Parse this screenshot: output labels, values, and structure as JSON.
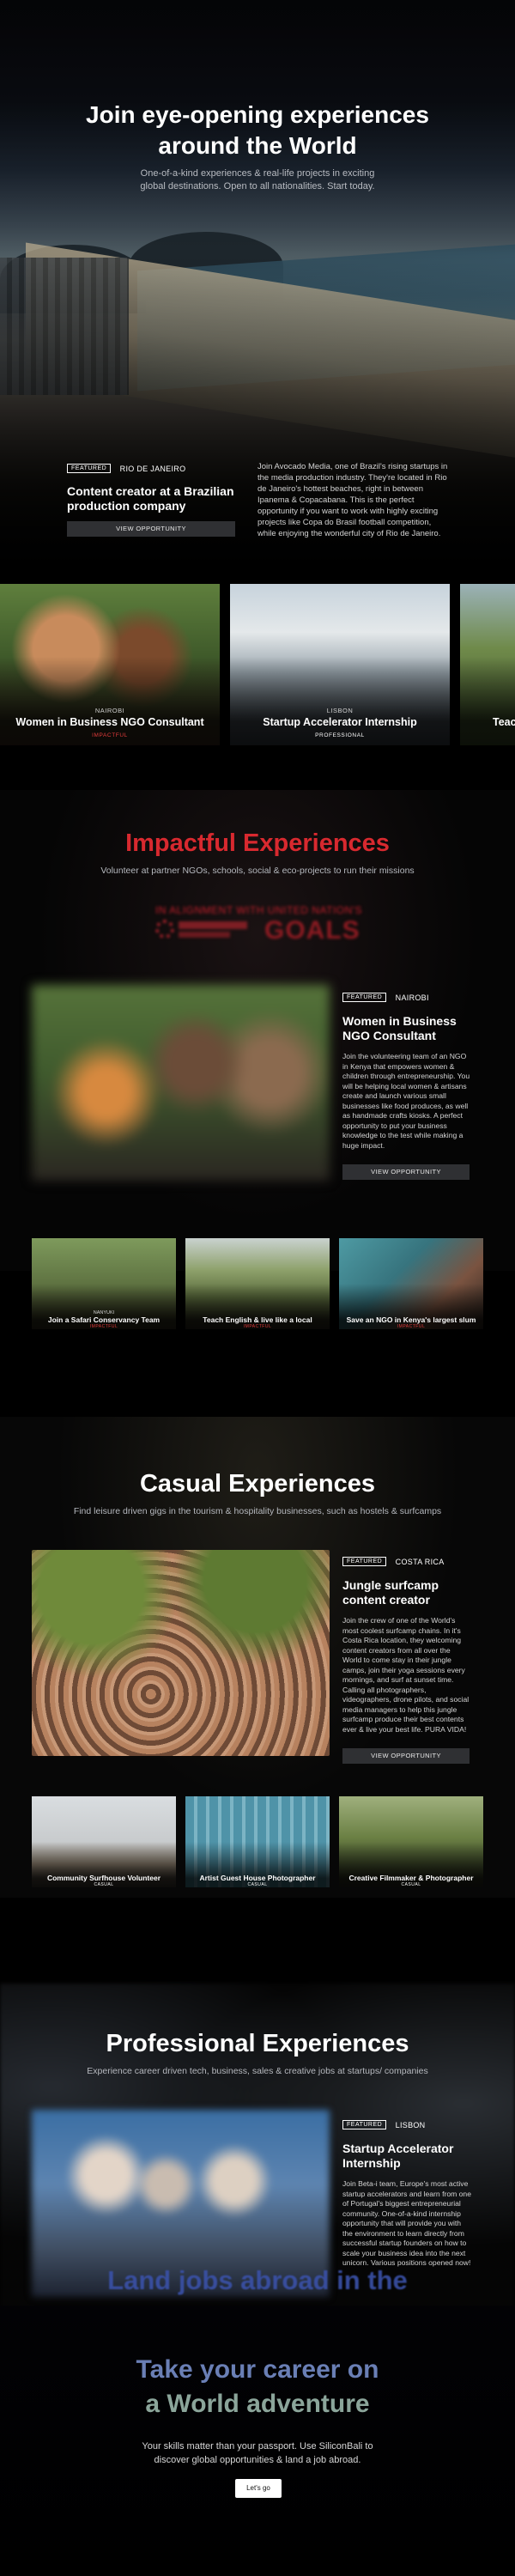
{
  "hero": {
    "title_line1": "Join eye-opening experiences",
    "title_line2": "around the World",
    "subtitle": "One-of-a-kind experiences & real-life projects in exciting global destinations. Open to all nationalities. Start today.",
    "featured": {
      "badge": "FEATURED",
      "location": "RIO DE JANEIRO",
      "title": "Content creator at a Brazilian production company",
      "button": "VIEW OPPORTUNITY",
      "description": "Join Avocado Media, one of Brazil's rising startups in the media production industry. They're located in Rio de Janeiro's hottest beaches, right in between Ipanema & Copacabana. This is the perfect opportunity if you want to work with highly exciting projects like Copa do Brasil football competition, while enjoying the wonderful city of Rio de Janeiro."
    }
  },
  "carousel": [
    {
      "sublabel": "NAIROBI",
      "title": "Women in Business NGO Consultant",
      "tag": "IMPACTFUL",
      "tag_color": "#e23b3b"
    },
    {
      "sublabel": "LISBON",
      "title": "Startup Accelerator Internship",
      "tag": "PROFESSIONAL",
      "tag_color": "#ffffff"
    },
    {
      "sublabel": "",
      "title": "Teac",
      "tag": "",
      "tag_color": "#ffffff"
    }
  ],
  "impactful": {
    "title": "Impactful Experiences",
    "title_color": "#d8292f",
    "subtitle": "Volunteer at partner NGOs, schools, social & eco-projects to run their missions",
    "sdg_text": "IN ALIGNMENT WITH UNITED NATION'S",
    "sdg_goals": "GOALS",
    "featured": {
      "badge": "FEATURED",
      "location": "NAIROBI",
      "title": "Women in Business NGO Consultant",
      "description": "Join the volunteering team of an NGO in Kenya that empowers women & children through entrepreneurship. You will be helping local women & artisans create and launch various small businesses like food produces, as well as handmade crafts kiosks. A perfect opportunity to put your business knowledge to the test while making a huge impact.",
      "button": "VIEW OPPORTUNITY"
    },
    "cards": [
      {
        "sublabel": "NANYUKI",
        "title": "Join a Safari Conservancy Team",
        "tag": "IMPACTFUL"
      },
      {
        "sublabel": "",
        "title": "Teach English & live like a local",
        "tag": "IMPACTFUL"
      },
      {
        "sublabel": "",
        "title": "Save an NGO in Kenya's largest slum",
        "tag": "IMPACTFUL"
      }
    ]
  },
  "casual": {
    "title": "Casual Experiences",
    "subtitle": "Find leisure driven gigs in the tourism & hospitality businesses, such as hostels & surfcamps",
    "featured": {
      "badge": "FEATURED",
      "location": "COSTA RICA",
      "title": "Jungle surfcamp content creator",
      "description": "Join the crew of one of the World's most coolest surfcamp chains. In it's Costa Rica location, they welcoming content creators from all over the World to come stay in their jungle camps, join their yoga sessions every mornings, and surf at sunset time. Calling all photographers, videographers, drone pilots, and social media managers to help this jungle surfcamp produce their best contents ever & live your best life. PURA VIDA!",
      "button": "VIEW OPPORTUNITY"
    },
    "cards": [
      {
        "sublabel": "",
        "title": "Community Surfhouse Volunteer",
        "tag": "CASUAL"
      },
      {
        "sublabel": "",
        "title": "Artist Guest House Photographer",
        "tag": "CASUAL"
      },
      {
        "sublabel": "",
        "title": "Creative Filmmaker & Photographer",
        "tag": "CASUAL"
      }
    ]
  },
  "professional": {
    "title": "Professional Experiences",
    "subtitle": "Experience career driven tech, business, sales & creative jobs at startups/ companies",
    "featured": {
      "badge": "FEATURED",
      "location": "LISBON",
      "title": "Startup Accelerator Internship",
      "description": "Join Beta-i team, Europe's most active startup accelerators and learn from one of Portugal's biggest entrepreneurial community. One-of-a-kind internship opportunity that will provide you with the environment to learn directly from successful startup founders on how to scale your business idea into the next unicorn. Various positions opened now!"
    }
  },
  "cta": {
    "ghost_text": "Land jobs abroad in the",
    "title_line1": "Take your career on",
    "title_line2": "a World adventure",
    "subtitle": "Your skills matter than your passport. Use SiliconBali to discover global opportunities & land a job abroad.",
    "button": "Let's go"
  }
}
